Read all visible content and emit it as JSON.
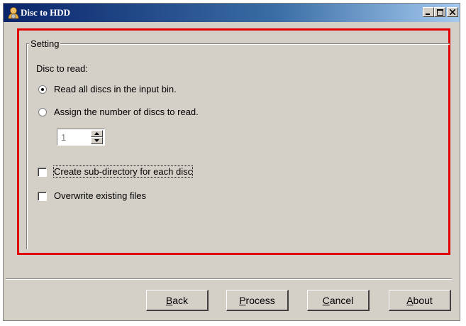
{
  "window": {
    "title": "Disc to HDD",
    "icon": "user-disc-icon"
  },
  "group": {
    "label": "Setting"
  },
  "disc_to_read": {
    "label": "Disc to read:",
    "option_all": "Read all discs in the input bin.",
    "option_assign": "Assign the number of discs to read.",
    "selected": "option_all",
    "count_value": "1"
  },
  "options": {
    "subdir_label": "Create sub-directory for each disc",
    "subdir_checked": false,
    "overwrite_label": "Overwrite existing files",
    "overwrite_checked": false
  },
  "buttons": {
    "back_mnemonic": "B",
    "back_rest": "ack",
    "process_mnemonic": "P",
    "process_rest": "rocess",
    "cancel_mnemonic": "C",
    "cancel_rest": "ancel",
    "about_mnemonic": "A",
    "about_rest": "bout"
  },
  "colors": {
    "highlight": "#e00000",
    "titlebar": "#0a246a",
    "face": "#d4d0c8"
  }
}
